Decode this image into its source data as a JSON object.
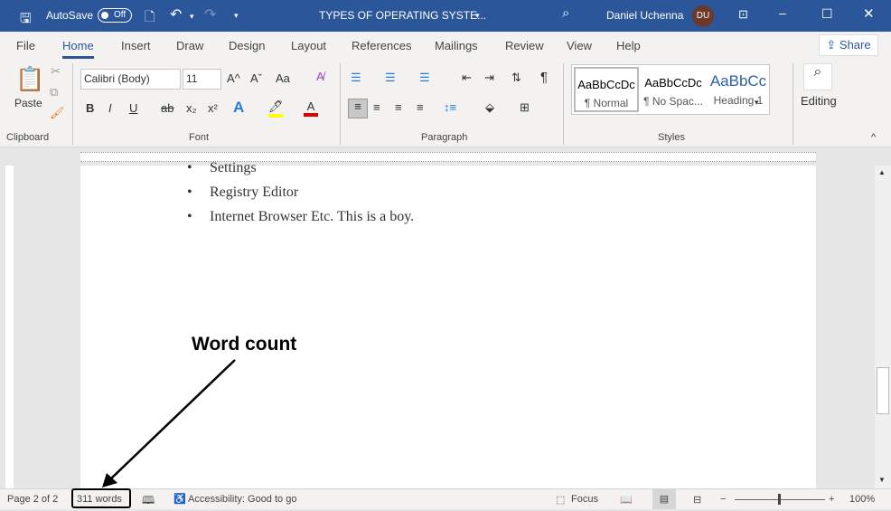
{
  "titlebar": {
    "autosave": "AutoSave",
    "autosave_state": "Off",
    "document_title": "TYPES OF OPERATING SYSTE...",
    "user_name": "Daniel Uchenna",
    "user_initials": "DU",
    "color": "#2b579a"
  },
  "tabs": [
    "File",
    "Home",
    "Insert",
    "Draw",
    "Design",
    "Layout",
    "References",
    "Mailings",
    "Review",
    "View",
    "Help"
  ],
  "active_tab": "Home",
  "share_label": "Share",
  "ribbon": {
    "clipboard": {
      "paste": "Paste",
      "group": "Clipboard"
    },
    "font": {
      "name": "Calibri (Body)",
      "size": "11",
      "grow": "A^",
      "shrink": "Aˇ",
      "case": "Aa",
      "bold": "B",
      "italic": "I",
      "underline": "U",
      "strike": "ab",
      "subscript": "x₂",
      "superscript": "x²",
      "group": "Font"
    },
    "paragraph": {
      "group": "Paragraph",
      "pilcrow": "¶"
    },
    "styles": {
      "items": [
        {
          "preview": "AaBbCcDc",
          "name": "¶ Normal"
        },
        {
          "preview": "AaBbCcDc",
          "name": "¶ No Spac..."
        },
        {
          "preview": "AaBbCc",
          "name": "Heading 1"
        }
      ],
      "group": "Styles"
    },
    "editing": {
      "label": "Editing"
    }
  },
  "document": {
    "bullets": [
      "Settings",
      "Registry Editor",
      "Internet Browser Etc. This is a boy."
    ]
  },
  "annotation": {
    "label": "Word count"
  },
  "status": {
    "page": "Page 2 of 2",
    "words": "311 words",
    "accessibility": "Accessibility: Good to go",
    "focus": "Focus",
    "zoom": "100%",
    "zoom_level": 100
  }
}
